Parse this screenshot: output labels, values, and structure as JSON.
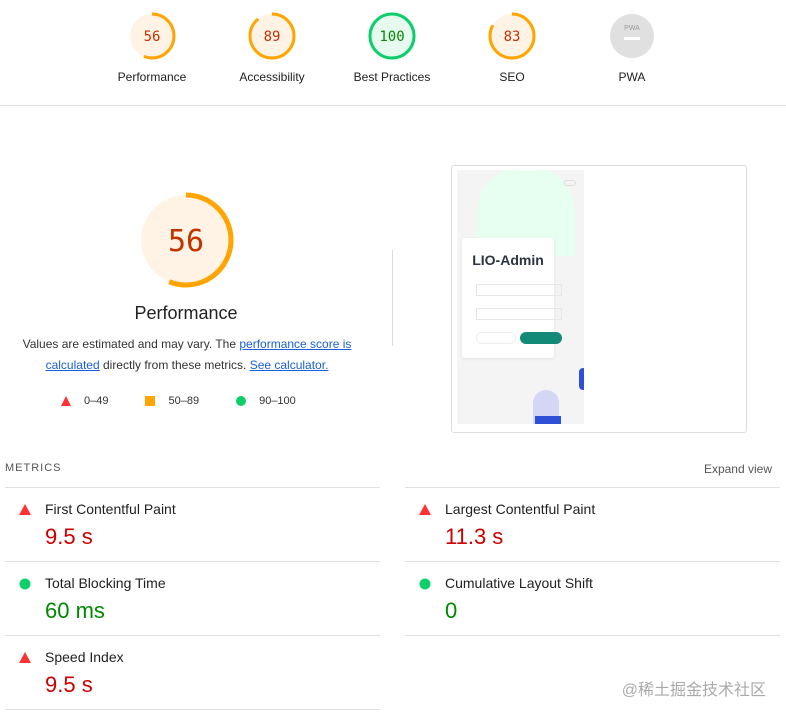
{
  "categories": [
    {
      "label": "Performance",
      "score": "56",
      "level": "average",
      "fraction": 0.56
    },
    {
      "label": "Accessibility",
      "score": "89",
      "level": "average",
      "fraction": 0.89
    },
    {
      "label": "Best Practices",
      "score": "100",
      "level": "pass",
      "fraction": 1.0
    },
    {
      "label": "SEO",
      "score": "83",
      "level": "average",
      "fraction": 0.83
    },
    {
      "label": "PWA",
      "score": "PWA",
      "level": "na",
      "fraction": 0
    }
  ],
  "colors": {
    "fail": "#ff3333",
    "average": "#ffa400",
    "pass": "#0cce6b",
    "fail_text": "#cc0000",
    "average_text": "#c33300",
    "pass_text": "#008800",
    "na": "#e0e0e0"
  },
  "main": {
    "score": "56",
    "fraction": 0.56,
    "title": "Performance",
    "desc_prefix": "Values are estimated and may vary. The ",
    "link1": "performance score is calculated",
    "desc_mid": " directly from these metrics. ",
    "link2": "See calculator."
  },
  "legend": [
    {
      "icon": "triangle",
      "range": "0–49"
    },
    {
      "icon": "square",
      "range": "50–89"
    },
    {
      "icon": "circle",
      "range": "90–100"
    }
  ],
  "screenshot": {
    "app_title": "LIO-Admin"
  },
  "metrics": {
    "heading": "METRICS",
    "expand": "Expand view",
    "items": [
      {
        "name": "First Contentful Paint",
        "value": "9.5 s",
        "level": "fail"
      },
      {
        "name": "Largest Contentful Paint",
        "value": "11.3 s",
        "level": "fail"
      },
      {
        "name": "Total Blocking Time",
        "value": "60 ms",
        "level": "pass"
      },
      {
        "name": "Cumulative Layout Shift",
        "value": "0",
        "level": "pass"
      },
      {
        "name": "Speed Index",
        "value": "9.5 s",
        "level": "fail"
      }
    ]
  },
  "watermark": "@稀土掘金技术社区"
}
